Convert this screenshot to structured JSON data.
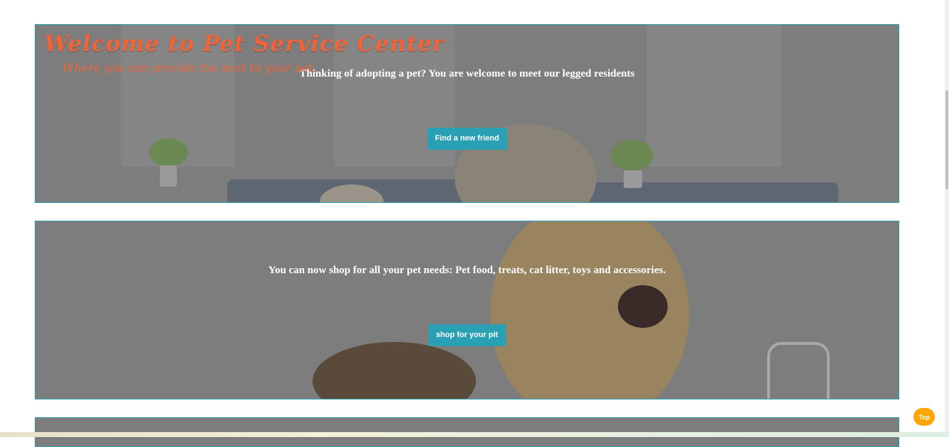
{
  "hero": {
    "title": "Welcome to Pet Service Center",
    "subtitle": "Where you can provide the best to your pet."
  },
  "sections": [
    {
      "text": "Thinking of adopting a pet? You are welcome to meet our legged residents",
      "button_label": "Find a new friend"
    },
    {
      "text": "You can now shop for all your pet needs: Pet food, treats, cat litter, toys and accessories.",
      "button_label": "shop for your pit"
    }
  ],
  "top_button_label": "Top",
  "colors": {
    "accent": "#2aa0b4",
    "title": "#f0643a",
    "top_button": "#ffa500"
  }
}
